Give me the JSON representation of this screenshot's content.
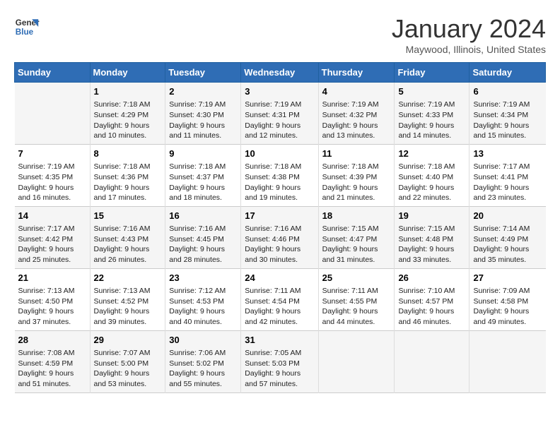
{
  "logo": {
    "line1": "General",
    "line2": "Blue"
  },
  "title": "January 2024",
  "subtitle": "Maywood, Illinois, United States",
  "headers": [
    "Sunday",
    "Monday",
    "Tuesday",
    "Wednesday",
    "Thursday",
    "Friday",
    "Saturday"
  ],
  "weeks": [
    [
      {
        "day": "",
        "sunrise": "",
        "sunset": "",
        "daylight": ""
      },
      {
        "day": "1",
        "sunrise": "Sunrise: 7:18 AM",
        "sunset": "Sunset: 4:29 PM",
        "daylight": "Daylight: 9 hours and 10 minutes."
      },
      {
        "day": "2",
        "sunrise": "Sunrise: 7:19 AM",
        "sunset": "Sunset: 4:30 PM",
        "daylight": "Daylight: 9 hours and 11 minutes."
      },
      {
        "day": "3",
        "sunrise": "Sunrise: 7:19 AM",
        "sunset": "Sunset: 4:31 PM",
        "daylight": "Daylight: 9 hours and 12 minutes."
      },
      {
        "day": "4",
        "sunrise": "Sunrise: 7:19 AM",
        "sunset": "Sunset: 4:32 PM",
        "daylight": "Daylight: 9 hours and 13 minutes."
      },
      {
        "day": "5",
        "sunrise": "Sunrise: 7:19 AM",
        "sunset": "Sunset: 4:33 PM",
        "daylight": "Daylight: 9 hours and 14 minutes."
      },
      {
        "day": "6",
        "sunrise": "Sunrise: 7:19 AM",
        "sunset": "Sunset: 4:34 PM",
        "daylight": "Daylight: 9 hours and 15 minutes."
      }
    ],
    [
      {
        "day": "7",
        "sunrise": "Sunrise: 7:19 AM",
        "sunset": "Sunset: 4:35 PM",
        "daylight": "Daylight: 9 hours and 16 minutes."
      },
      {
        "day": "8",
        "sunrise": "Sunrise: 7:18 AM",
        "sunset": "Sunset: 4:36 PM",
        "daylight": "Daylight: 9 hours and 17 minutes."
      },
      {
        "day": "9",
        "sunrise": "Sunrise: 7:18 AM",
        "sunset": "Sunset: 4:37 PM",
        "daylight": "Daylight: 9 hours and 18 minutes."
      },
      {
        "day": "10",
        "sunrise": "Sunrise: 7:18 AM",
        "sunset": "Sunset: 4:38 PM",
        "daylight": "Daylight: 9 hours and 19 minutes."
      },
      {
        "day": "11",
        "sunrise": "Sunrise: 7:18 AM",
        "sunset": "Sunset: 4:39 PM",
        "daylight": "Daylight: 9 hours and 21 minutes."
      },
      {
        "day": "12",
        "sunrise": "Sunrise: 7:18 AM",
        "sunset": "Sunset: 4:40 PM",
        "daylight": "Daylight: 9 hours and 22 minutes."
      },
      {
        "day": "13",
        "sunrise": "Sunrise: 7:17 AM",
        "sunset": "Sunset: 4:41 PM",
        "daylight": "Daylight: 9 hours and 23 minutes."
      }
    ],
    [
      {
        "day": "14",
        "sunrise": "Sunrise: 7:17 AM",
        "sunset": "Sunset: 4:42 PM",
        "daylight": "Daylight: 9 hours and 25 minutes."
      },
      {
        "day": "15",
        "sunrise": "Sunrise: 7:16 AM",
        "sunset": "Sunset: 4:43 PM",
        "daylight": "Daylight: 9 hours and 26 minutes."
      },
      {
        "day": "16",
        "sunrise": "Sunrise: 7:16 AM",
        "sunset": "Sunset: 4:45 PM",
        "daylight": "Daylight: 9 hours and 28 minutes."
      },
      {
        "day": "17",
        "sunrise": "Sunrise: 7:16 AM",
        "sunset": "Sunset: 4:46 PM",
        "daylight": "Daylight: 9 hours and 30 minutes."
      },
      {
        "day": "18",
        "sunrise": "Sunrise: 7:15 AM",
        "sunset": "Sunset: 4:47 PM",
        "daylight": "Daylight: 9 hours and 31 minutes."
      },
      {
        "day": "19",
        "sunrise": "Sunrise: 7:15 AM",
        "sunset": "Sunset: 4:48 PM",
        "daylight": "Daylight: 9 hours and 33 minutes."
      },
      {
        "day": "20",
        "sunrise": "Sunrise: 7:14 AM",
        "sunset": "Sunset: 4:49 PM",
        "daylight": "Daylight: 9 hours and 35 minutes."
      }
    ],
    [
      {
        "day": "21",
        "sunrise": "Sunrise: 7:13 AM",
        "sunset": "Sunset: 4:50 PM",
        "daylight": "Daylight: 9 hours and 37 minutes."
      },
      {
        "day": "22",
        "sunrise": "Sunrise: 7:13 AM",
        "sunset": "Sunset: 4:52 PM",
        "daylight": "Daylight: 9 hours and 39 minutes."
      },
      {
        "day": "23",
        "sunrise": "Sunrise: 7:12 AM",
        "sunset": "Sunset: 4:53 PM",
        "daylight": "Daylight: 9 hours and 40 minutes."
      },
      {
        "day": "24",
        "sunrise": "Sunrise: 7:11 AM",
        "sunset": "Sunset: 4:54 PM",
        "daylight": "Daylight: 9 hours and 42 minutes."
      },
      {
        "day": "25",
        "sunrise": "Sunrise: 7:11 AM",
        "sunset": "Sunset: 4:55 PM",
        "daylight": "Daylight: 9 hours and 44 minutes."
      },
      {
        "day": "26",
        "sunrise": "Sunrise: 7:10 AM",
        "sunset": "Sunset: 4:57 PM",
        "daylight": "Daylight: 9 hours and 46 minutes."
      },
      {
        "day": "27",
        "sunrise": "Sunrise: 7:09 AM",
        "sunset": "Sunset: 4:58 PM",
        "daylight": "Daylight: 9 hours and 49 minutes."
      }
    ],
    [
      {
        "day": "28",
        "sunrise": "Sunrise: 7:08 AM",
        "sunset": "Sunset: 4:59 PM",
        "daylight": "Daylight: 9 hours and 51 minutes."
      },
      {
        "day": "29",
        "sunrise": "Sunrise: 7:07 AM",
        "sunset": "Sunset: 5:00 PM",
        "daylight": "Daylight: 9 hours and 53 minutes."
      },
      {
        "day": "30",
        "sunrise": "Sunrise: 7:06 AM",
        "sunset": "Sunset: 5:02 PM",
        "daylight": "Daylight: 9 hours and 55 minutes."
      },
      {
        "day": "31",
        "sunrise": "Sunrise: 7:05 AM",
        "sunset": "Sunset: 5:03 PM",
        "daylight": "Daylight: 9 hours and 57 minutes."
      },
      {
        "day": "",
        "sunrise": "",
        "sunset": "",
        "daylight": ""
      },
      {
        "day": "",
        "sunrise": "",
        "sunset": "",
        "daylight": ""
      },
      {
        "day": "",
        "sunrise": "",
        "sunset": "",
        "daylight": ""
      }
    ]
  ]
}
